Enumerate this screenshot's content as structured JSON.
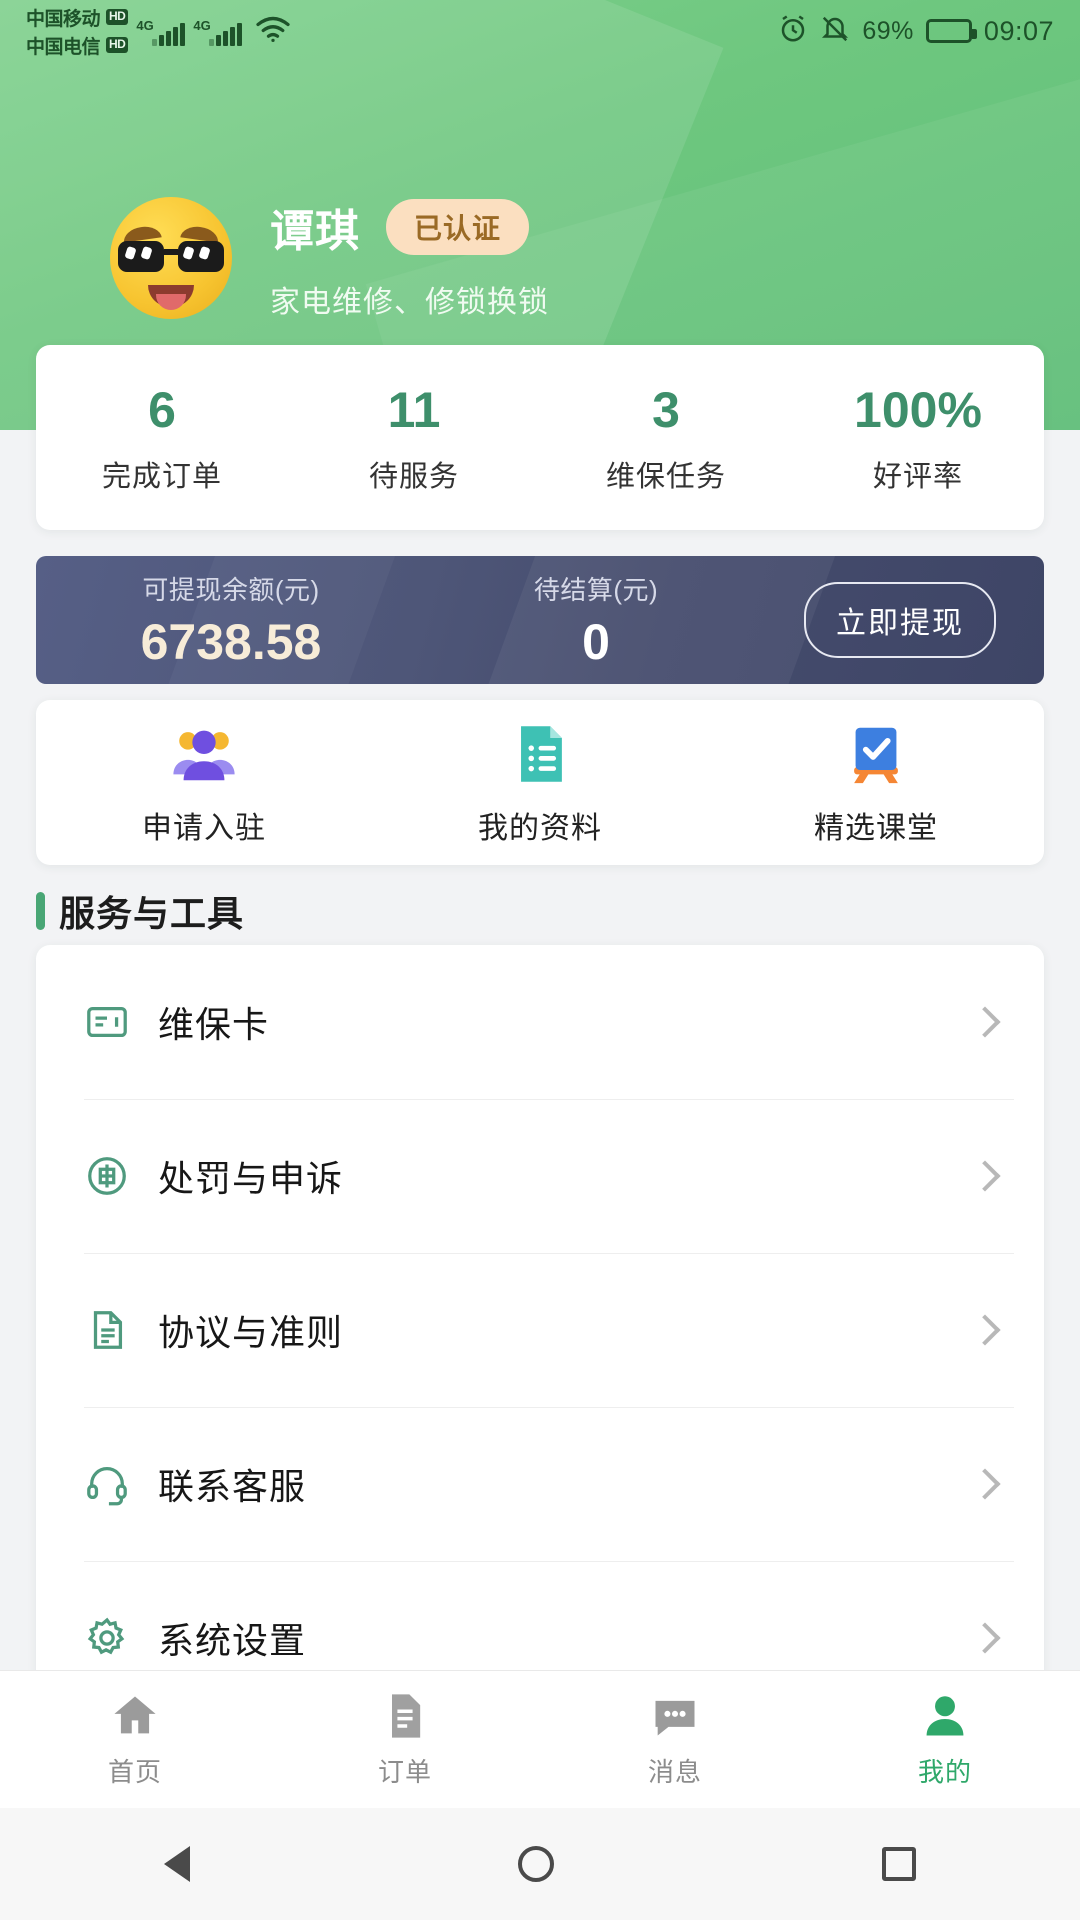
{
  "statusbar": {
    "carriers": [
      {
        "name": "中国移动",
        "badge": "HD",
        "net": "4G"
      },
      {
        "name": "中国电信",
        "badge": "HD",
        "net": "4G"
      }
    ],
    "alarm_icon": "alarm-clock-icon",
    "mute_icon": "bell-muted-icon",
    "battery_percent": "69%",
    "battery_level": 69,
    "time": "09:07"
  },
  "profile": {
    "avatar_icon": "sunglasses-emoji-avatar",
    "name": "谭琪",
    "verified_label": "已认证",
    "subtitle": "家电维修、修锁换锁"
  },
  "stats": [
    {
      "value": "6",
      "label": "完成订单"
    },
    {
      "value": "11",
      "label": "待服务"
    },
    {
      "value": "3",
      "label": "维保任务"
    },
    {
      "value": "100%",
      "label": "好评率"
    }
  ],
  "wallet": {
    "balance_label": "可提现余额(元)",
    "balance_value": "6738.58",
    "pending_label": "待结算(元)",
    "pending_value": "0",
    "withdraw_label": "立即提现"
  },
  "quick_actions": [
    {
      "label": "申请入驻",
      "icon": "people-group-icon"
    },
    {
      "label": "我的资料",
      "icon": "document-list-icon"
    },
    {
      "label": "精选课堂",
      "icon": "whiteboard-check-icon"
    }
  ],
  "section": {
    "title": "服务与工具"
  },
  "menu": [
    {
      "label": "维保卡",
      "icon": "maintenance-card-icon"
    },
    {
      "label": "处罚与申诉",
      "icon": "penalty-appeal-icon"
    },
    {
      "label": "协议与准则",
      "icon": "agreement-document-icon"
    },
    {
      "label": "联系客服",
      "icon": "headset-support-icon"
    },
    {
      "label": "系统设置",
      "icon": "gear-settings-icon"
    }
  ],
  "tabs": [
    {
      "label": "首页",
      "icon": "home-icon",
      "active": false
    },
    {
      "label": "订单",
      "icon": "orders-icon",
      "active": false
    },
    {
      "label": "消息",
      "icon": "messages-icon",
      "active": false
    },
    {
      "label": "我的",
      "icon": "profile-icon",
      "active": true
    }
  ],
  "navbar": {
    "back_icon": "triangle-back-icon",
    "home_icon": "circle-home-icon",
    "recents_icon": "square-recents-icon"
  },
  "colors": {
    "header_green": "#6ec77f",
    "accent_green": "#2fa86a",
    "stat_green": "#3e8f6b",
    "wallet_navy": "#4e5678",
    "balance_cream": "#f7ecd8",
    "badge_bg": "#fbdfc0",
    "badge_text": "#9a6a25"
  }
}
